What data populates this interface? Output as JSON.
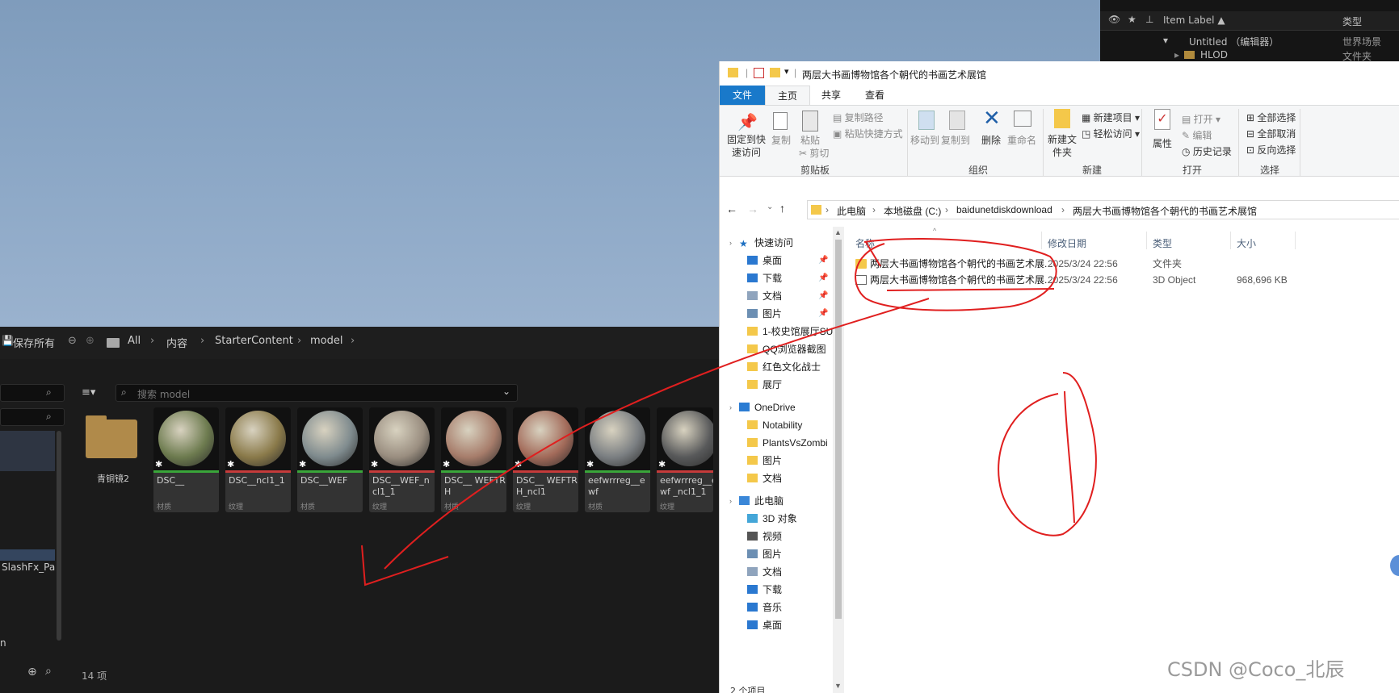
{
  "outliner": {
    "col_label": "Item Label ▲",
    "col_type": "类型",
    "rows": [
      {
        "label": "Untitled （编辑器）",
        "type": "世界场景"
      },
      {
        "label": "HLOD",
        "type": "文件夹"
      }
    ]
  },
  "ue_browser": {
    "save_all": "保存所有",
    "breadcrumb": [
      "All",
      "内容",
      "StarterContent",
      "model"
    ],
    "search_placeholder": "搜索 model",
    "left_item": "SlashFx_Pa",
    "left_item2": "n",
    "item_count": "14 项",
    "folder": {
      "name": "青铜镜2"
    },
    "assets": [
      {
        "name": "DSC__",
        "type": "材质",
        "line": "#3aa63a",
        "color": "#6d7b4f"
      },
      {
        "name": "DSC__ncl1_1",
        "type": "纹理",
        "line": "#c63b3b",
        "color": "#8a7a4a"
      },
      {
        "name": "DSC__WEF",
        "type": "材质",
        "line": "#3aa63a",
        "color": "#7f8b8e"
      },
      {
        "name": "DSC__WEF_ncl1_1",
        "type": "纹理",
        "line": "#c63b3b",
        "color": "#9a8e80"
      },
      {
        "name": "DSC__ WEFTRH",
        "type": "材质",
        "line": "#3aa63a",
        "color": "#a77d6b"
      },
      {
        "name": "DSC__ WEFTRH_ncl1",
        "type": "纹理",
        "line": "#c63b3b",
        "color": "#a36b5a"
      },
      {
        "name": "eefwrrreg__ewf",
        "type": "材质",
        "line": "#3aa63a",
        "color": "#7b7f82"
      },
      {
        "name": "eefwrrreg__ewf _ncl1_1",
        "type": "纹理",
        "line": "#c63b3b",
        "color": "#58595a"
      }
    ]
  },
  "explorer": {
    "title": "两层大书画博物馆各个朝代的书画艺术展馆",
    "tabs": [
      "文件",
      "主页",
      "共享",
      "查看"
    ],
    "ribbon": {
      "pin": "固定到快速访问",
      "copy": "复制",
      "paste": "粘贴",
      "copy_path": "复制路径",
      "paste_shortcut": "粘贴快捷方式",
      "cut": "剪切",
      "clipboard": "剪贴板",
      "move_to": "移动到",
      "copy_to": "复制到",
      "delete": "删除",
      "rename": "重命名",
      "organize": "组织",
      "new_folder": "新建文件夹",
      "new_item": "新建项目 ▾",
      "easy_access": "轻松访问 ▾",
      "new": "新建",
      "properties": "属性",
      "open": "打开 ▾",
      "edit": "编辑",
      "history": "历史记录",
      "open_group": "打开",
      "select_all": "全部选择",
      "select_none": "全部取消",
      "invert": "反向选择",
      "select": "选择"
    },
    "path": [
      "此电脑",
      "本地磁盘 (C:)",
      "baidunetdiskdownload",
      "两层大书画博物馆各个朝代的书画艺术展馆"
    ],
    "nav": [
      {
        "label": "快速访问",
        "icon": "star-icon",
        "pin": false
      },
      {
        "label": "桌面",
        "icon": "desktop-icon",
        "pin": true
      },
      {
        "label": "下载",
        "icon": "download-icon",
        "pin": true
      },
      {
        "label": "文档",
        "icon": "document-icon",
        "pin": true
      },
      {
        "label": "图片",
        "icon": "picture-icon",
        "pin": true
      },
      {
        "label": "1-校史馆展厅SU",
        "icon": "folder-icon",
        "pin": false
      },
      {
        "label": "QQ浏览器截图",
        "icon": "folder-icon",
        "pin": false
      },
      {
        "label": "红色文化战士",
        "icon": "folder-icon",
        "pin": false
      },
      {
        "label": "展厅",
        "icon": "folder-icon",
        "pin": false
      },
      {
        "label": "OneDrive",
        "icon": "cloud-icon",
        "pin": false
      },
      {
        "label": "Notability",
        "icon": "folder-icon",
        "pin": false
      },
      {
        "label": "PlantsVsZombi",
        "icon": "folder-icon",
        "pin": false
      },
      {
        "label": "图片",
        "icon": "folder-icon",
        "pin": false
      },
      {
        "label": "文档",
        "icon": "folder-icon",
        "pin": false
      },
      {
        "label": "此电脑",
        "icon": "computer-icon",
        "pin": false
      },
      {
        "label": "3D 对象",
        "icon": "3d-objects-icon",
        "pin": false
      },
      {
        "label": "视频",
        "icon": "video-icon",
        "pin": false
      },
      {
        "label": "图片",
        "icon": "picture-icon",
        "pin": false
      },
      {
        "label": "文档",
        "icon": "document-icon",
        "pin": false
      },
      {
        "label": "下载",
        "icon": "download-icon",
        "pin": false
      },
      {
        "label": "音乐",
        "icon": "music-icon",
        "pin": false
      },
      {
        "label": "桌面",
        "icon": "desktop-icon",
        "pin": false
      }
    ],
    "columns": [
      "名称",
      "修改日期",
      "类型",
      "大小"
    ],
    "files": [
      {
        "name": "两层大书画博物馆各个朝代的书画艺术展...",
        "date": "2025/3/24 22:56",
        "type": "文件夹",
        "size": ""
      },
      {
        "name": "两层大书画博物馆各个朝代的书画艺术展...",
        "date": "2025/3/24 22:56",
        "type": "3D Object",
        "size": "968,696 KB"
      }
    ],
    "status": "2 个项目"
  },
  "watermark": "CSDN @Coco_北辰",
  "colors": {
    "annotation": "#e01f1f",
    "ribbon_tab": "#1979ca"
  }
}
